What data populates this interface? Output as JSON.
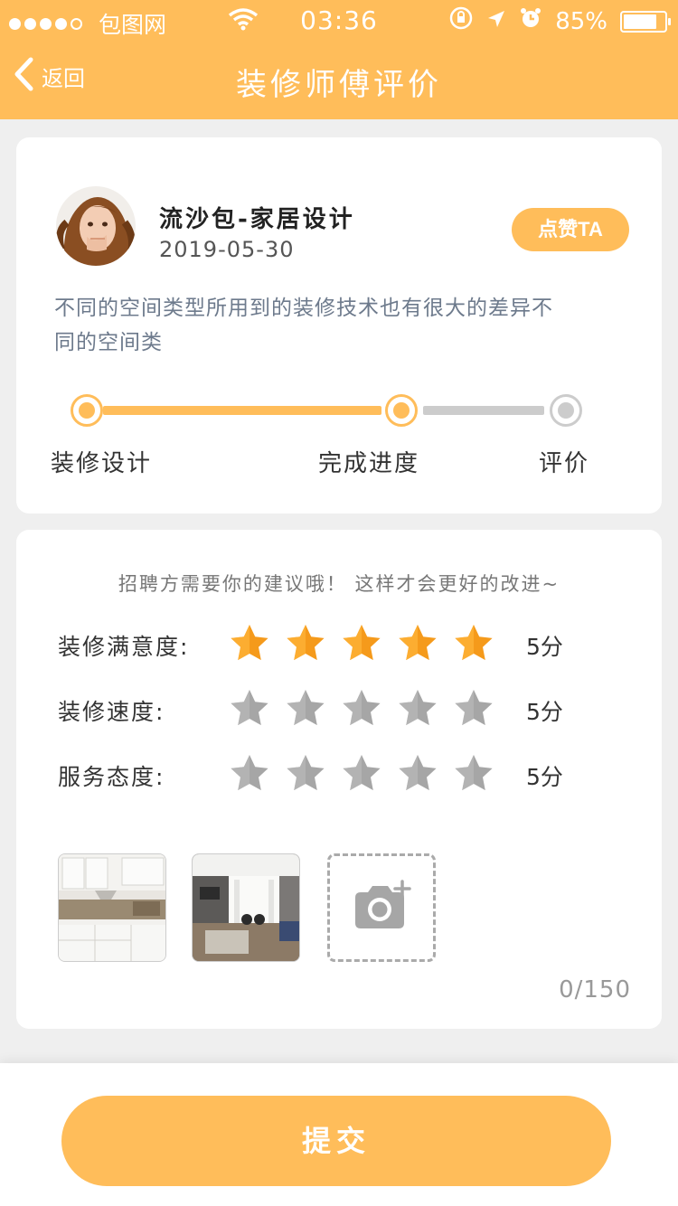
{
  "status_bar": {
    "carrier": "包图网",
    "time": "03:36",
    "battery": "85%",
    "battery_level": 0.85
  },
  "nav": {
    "back_label": "返回",
    "title": "装修师傅评价"
  },
  "review": {
    "username": "流沙包-家居设计",
    "date": "2019-05-30",
    "like_label": "点赞TA",
    "description": "不同的空间类型所用到的装修技术也有很大的差异不同的空间类"
  },
  "progress": {
    "steps": [
      {
        "label": "装修设计",
        "done": true
      },
      {
        "label": "完成进度",
        "done": true
      },
      {
        "label": "评价",
        "done": false
      }
    ]
  },
  "rating": {
    "prompt": "招聘方需要你的建议哦！ 这样才会更好的改进~",
    "rows": [
      {
        "label": "装修满意度:",
        "score": "5分",
        "stars": 5,
        "active": true
      },
      {
        "label": "装修速度:",
        "score": "5分",
        "stars": 5,
        "active": false
      },
      {
        "label": "服务态度:",
        "score": "5分",
        "stars": 5,
        "active": false
      }
    ]
  },
  "photos": {
    "items": [
      "kitchen-photo",
      "living-room-photo"
    ],
    "counter": "0/150"
  },
  "submit_label": "提交",
  "colors": {
    "accent": "#ffbd5a",
    "star_active": "#f59a1b",
    "star_inactive": "#a6a6a6"
  }
}
